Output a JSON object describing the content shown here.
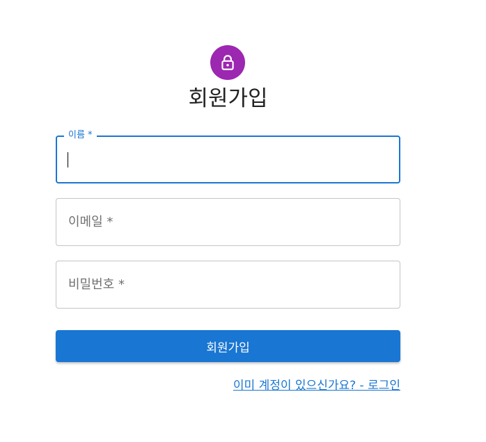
{
  "header": {
    "icon": "lock-icon",
    "icon_color": "#9c27b0",
    "title": "회원가입"
  },
  "form": {
    "name_field": {
      "label": "이름 *",
      "value": "",
      "focused": true
    },
    "email_field": {
      "placeholder": "이메일 *",
      "value": ""
    },
    "password_field": {
      "placeholder": "비밀번호 *",
      "value": ""
    },
    "submit_label": "회원가입",
    "accent_color": "#1976d2"
  },
  "footer": {
    "login_link": "이미 계정이 있으신가요? - 로그인"
  }
}
